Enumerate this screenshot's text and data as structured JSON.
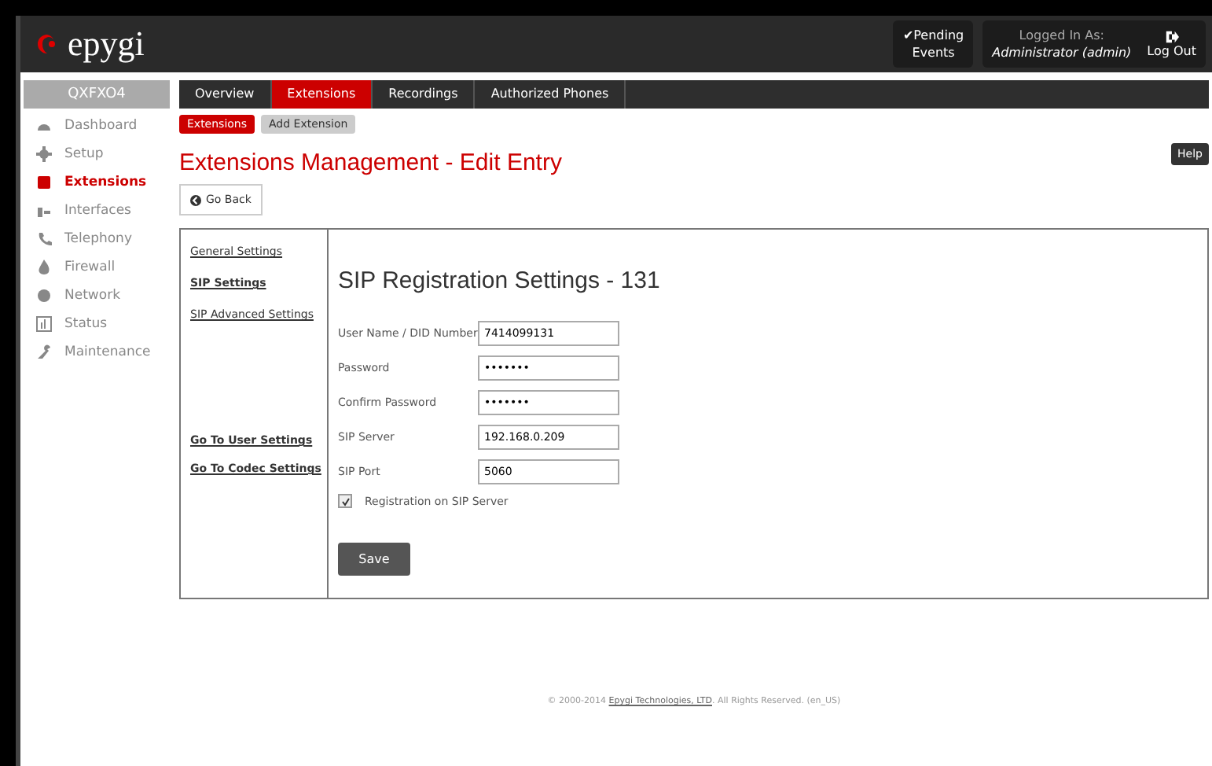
{
  "header": {
    "logo": "epygi",
    "pending": [
      "✔Pending",
      "Events"
    ],
    "logged_label": "Logged In As:",
    "user": "Administrator (admin)",
    "logout": "Log Out"
  },
  "device": "QXFXO4",
  "sidebar": [
    {
      "label": "Dashboard",
      "selected": false
    },
    {
      "label": "Setup",
      "selected": false
    },
    {
      "label": "Extensions",
      "selected": true
    },
    {
      "label": "Interfaces",
      "selected": false
    },
    {
      "label": "Telephony",
      "selected": false
    },
    {
      "label": "Firewall",
      "selected": false
    },
    {
      "label": "Network",
      "selected": false
    },
    {
      "label": "Status",
      "selected": false
    },
    {
      "label": "Maintenance",
      "selected": false
    }
  ],
  "tabs": [
    {
      "label": "Overview",
      "selected": false
    },
    {
      "label": "Extensions",
      "selected": true
    },
    {
      "label": "Recordings",
      "selected": false
    },
    {
      "label": "Authorized Phones",
      "selected": false
    }
  ],
  "subtabs": [
    {
      "label": "Extensions",
      "selected": true
    },
    {
      "label": "Add Extension",
      "selected": false
    }
  ],
  "title": "Extensions Management - Edit Entry",
  "help": "Help",
  "go_back": "Go Back",
  "side_links": [
    {
      "label": "General Settings",
      "selected": false
    },
    {
      "label": "SIP Settings",
      "selected": true
    },
    {
      "label": "SIP Advanced Settings",
      "selected": false
    }
  ],
  "bottom_links": [
    "Go To User Settings",
    "Go To Codec Settings"
  ],
  "form": {
    "title": "SIP Registration Settings - 131",
    "fields": [
      {
        "label": "User Name / DID Number",
        "value": "7414099131"
      },
      {
        "label": "Password",
        "value": "•••••••"
      },
      {
        "label": "Confirm Password",
        "value": "•••••••"
      },
      {
        "label": "SIP Server",
        "value": "192.168.0.209"
      },
      {
        "label": "SIP Port",
        "value": "5060"
      }
    ],
    "checkbox": {
      "label": "Registration on SIP Server",
      "checked": true
    },
    "save": "Save"
  },
  "footer": {
    "before": "© 2000-2014 ",
    "link": "Epygi Technologies, LTD",
    "after": ". All Rights Reserved. (en_US)"
  }
}
